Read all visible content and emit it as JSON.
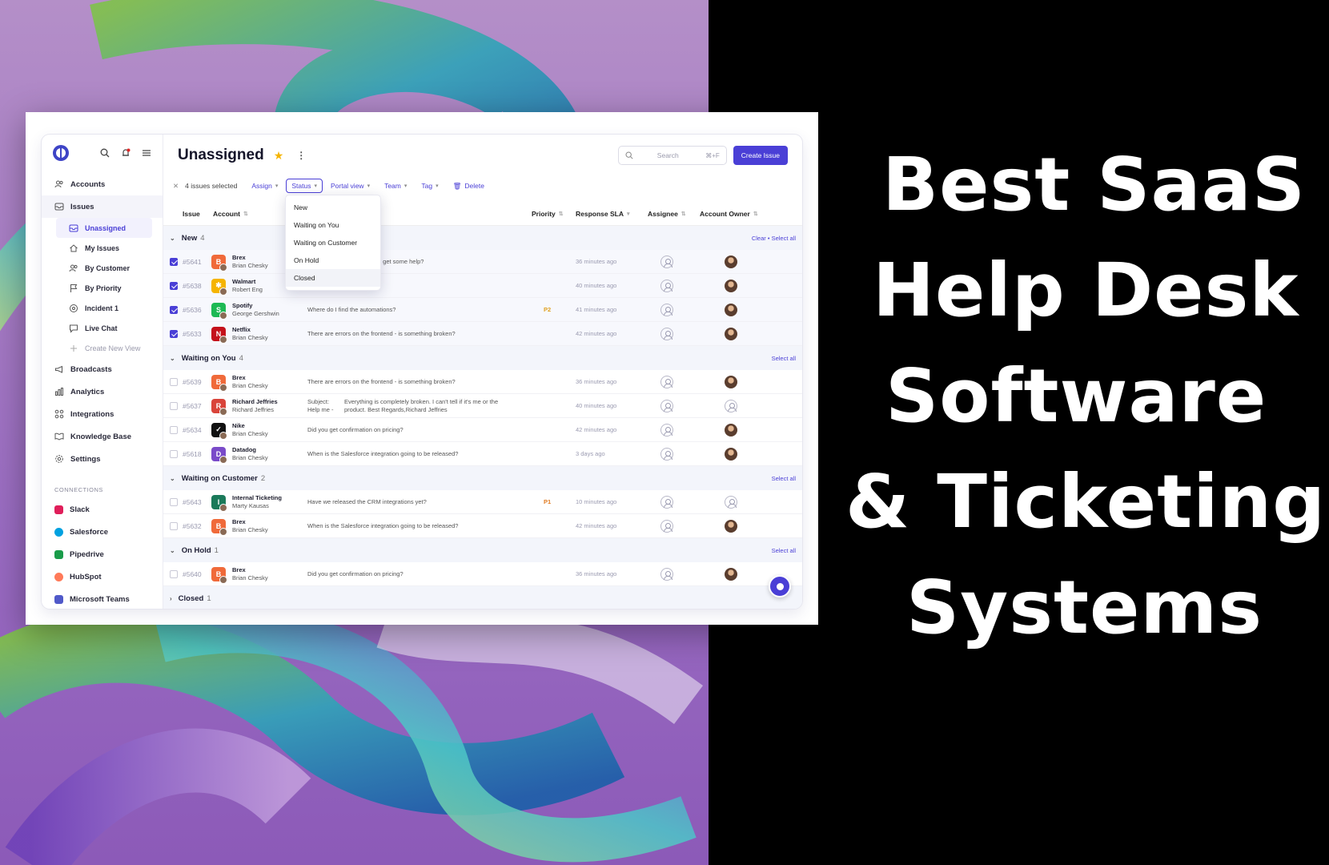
{
  "headline": [
    "Best SaaS",
    "Help Desk",
    "Software",
    "& Ticketing",
    "Systems"
  ],
  "colors": {
    "accent": "#4a3fd6",
    "priority_p1": "#e07a20",
    "priority_p2": "#e0a020"
  },
  "sidebar": {
    "nav": [
      {
        "label": "Accounts",
        "icon": "users-icon"
      },
      {
        "label": "Issues",
        "icon": "inbox-icon"
      }
    ],
    "issue_views": [
      {
        "label": "Unassigned",
        "icon": "inbox-icon"
      },
      {
        "label": "My Issues",
        "icon": "home-icon"
      },
      {
        "label": "By Customer",
        "icon": "users-icon"
      },
      {
        "label": "By Priority",
        "icon": "flag-icon"
      },
      {
        "label": "Incident 1",
        "icon": "incident-icon"
      },
      {
        "label": "Live Chat",
        "icon": "chat-icon"
      },
      {
        "label": "Create New View",
        "icon": "plus-icon"
      }
    ],
    "nav2": [
      {
        "label": "Broadcasts",
        "icon": "megaphone-icon"
      },
      {
        "label": "Analytics",
        "icon": "chart-icon"
      },
      {
        "label": "Integrations",
        "icon": "integrations-icon"
      },
      {
        "label": "Knowledge Base",
        "icon": "book-icon"
      },
      {
        "label": "Settings",
        "icon": "gear-icon"
      }
    ],
    "connections_label": "CONNECTIONS",
    "connections": [
      {
        "label": "Slack",
        "color": "#e01e5a"
      },
      {
        "label": "Salesforce",
        "color": "#00a1e0"
      },
      {
        "label": "Pipedrive",
        "color": "#1a9c4a"
      },
      {
        "label": "HubSpot",
        "color": "#ff7a59"
      },
      {
        "label": "Microsoft Teams",
        "color": "#5059c9"
      }
    ]
  },
  "header": {
    "title": "Unassigned",
    "search_placeholder": "Search",
    "search_shortcut": "⌘+F",
    "create_label": "Create Issue"
  },
  "toolbar": {
    "selected": "4 issues selected",
    "assign": "Assign",
    "status": "Status",
    "portal": "Portal view",
    "team": "Team",
    "tag": "Tag",
    "delete": "Delete"
  },
  "columns": {
    "issue": "Issue",
    "account": "Account",
    "priority": "Priority",
    "sla": "Response SLA",
    "assignee": "Assignee",
    "owner": "Account Owner"
  },
  "status_menu": [
    "New",
    "Waiting on You",
    "Waiting on Customer",
    "On Hold",
    "Closed"
  ],
  "groups": [
    {
      "name": "New",
      "count": "4",
      "clear": "Clear",
      "select": "Select all",
      "rows": [
        {
          "id": "#5641",
          "account": "Brex",
          "person": "Brian Chesky",
          "logo": "B",
          "logo_color": "#f06a3a",
          "subject": "I get some help?",
          "priority": "",
          "sla": "36 minutes ago",
          "checked": true,
          "owner_empty": false
        },
        {
          "id": "#5638",
          "account": "Walmart",
          "person": "Robert Eng",
          "logo": "✱",
          "logo_color": "#f5b400",
          "subject": "",
          "priority": "",
          "sla": "40 minutes ago",
          "checked": true,
          "owner_empty": false
        },
        {
          "id": "#5636",
          "account": "Spotify",
          "person": "George Gershwin",
          "logo": "S",
          "logo_color": "#1db954",
          "subject": "Where do I find the automations?",
          "priority": "P2",
          "sla": "41 minutes ago",
          "checked": true,
          "owner_empty": false
        },
        {
          "id": "#5633",
          "account": "Netflix",
          "person": "Brian Chesky",
          "logo": "N",
          "logo_color": "#c4101a",
          "subject": "There are errors on the frontend - is something broken?",
          "priority": "",
          "sla": "42 minutes ago",
          "checked": true,
          "owner_empty": false
        }
      ]
    },
    {
      "name": "Waiting on You",
      "count": "4",
      "select": "Select all",
      "rows": [
        {
          "id": "#5639",
          "account": "Brex",
          "person": "Brian Chesky",
          "logo": "B",
          "logo_color": "#f06a3a",
          "subject": "There are errors on the frontend - is something broken?",
          "priority": "",
          "sla": "36 minutes ago",
          "checked": false,
          "owner_empty": false
        },
        {
          "id": "#5637",
          "account": "Richard Jeffries",
          "person": "Richard Jeffries",
          "logo": "R",
          "logo_color": "#d9443a",
          "subject_a": "Subject:",
          "subject_b": "Help me -",
          "subject_c": "Everything is completely broken. I can't tell if it's me or the",
          "subject_d": "product. Best Regards,Richard Jeffries",
          "priority": "",
          "sla": "40 minutes ago",
          "checked": false,
          "owner_empty": true
        },
        {
          "id": "#5634",
          "account": "Nike",
          "person": "Brian Chesky",
          "logo": "✓",
          "logo_color": "#111111",
          "subject": "Did you get confirmation on pricing?",
          "priority": "",
          "sla": "42 minutes ago",
          "checked": false,
          "owner_empty": false
        },
        {
          "id": "#5618",
          "account": "Datadog",
          "person": "Brian Chesky",
          "logo": "D",
          "logo_color": "#7a4bc9",
          "subject": "When is the Salesforce integration going to be released?",
          "priority": "",
          "sla": "3 days ago",
          "checked": false,
          "owner_empty": false
        }
      ]
    },
    {
      "name": "Waiting on Customer",
      "count": "2",
      "select": "Select all",
      "rows": [
        {
          "id": "#5643",
          "account": "Internal Ticketing",
          "person": "Marty Kausas",
          "logo": "I",
          "logo_color": "#1b7a5a",
          "subject": "Have we released the CRM integrations yet?",
          "priority": "P1",
          "sla": "10 minutes ago",
          "checked": false,
          "owner_empty": true
        },
        {
          "id": "#5632",
          "account": "Brex",
          "person": "Brian Chesky",
          "logo": "B",
          "logo_color": "#f06a3a",
          "subject": "When is the Salesforce integration going to be released?",
          "priority": "",
          "sla": "42 minutes ago",
          "checked": false,
          "owner_empty": false
        }
      ]
    },
    {
      "name": "On Hold",
      "count": "1",
      "select": "Select all",
      "rows": [
        {
          "id": "#5640",
          "account": "Brex",
          "person": "Brian Chesky",
          "logo": "B",
          "logo_color": "#f06a3a",
          "subject": "Did you get confirmation on pricing?",
          "priority": "",
          "sla": "36 minutes ago",
          "checked": false,
          "owner_empty": false
        }
      ]
    },
    {
      "name": "Closed",
      "count": "1",
      "collapsed": true,
      "rows": []
    }
  ]
}
